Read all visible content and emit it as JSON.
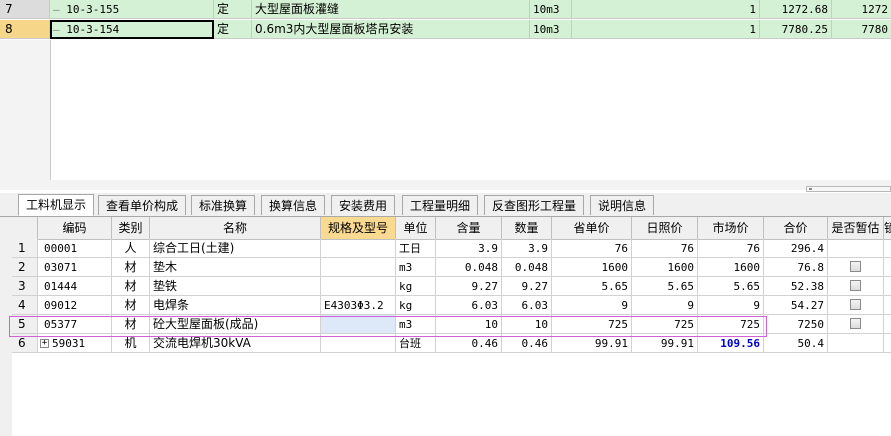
{
  "top_grid": {
    "rows": [
      {
        "num": "7",
        "code": "10-3-155",
        "type": "定",
        "name": "大型屋面板灌缝",
        "unit": "10m3",
        "qty": "1",
        "price": "1272.68",
        "total": "1272",
        "selected": false
      },
      {
        "num": "8",
        "code": "10-3-154",
        "type": "定",
        "name": "0.6m3内大型屋面板塔吊安装",
        "unit": "10m3",
        "qty": "1",
        "price": "7780.25",
        "total": "7780",
        "selected": true
      }
    ]
  },
  "tabs": [
    {
      "label": "工料机显示",
      "active": true
    },
    {
      "label": "查看单价构成",
      "active": false
    },
    {
      "label": "标准换算",
      "active": false
    },
    {
      "label": "换算信息",
      "active": false
    },
    {
      "label": "安装费用",
      "active": false
    },
    {
      "label": "工程量明细",
      "active": false
    },
    {
      "label": "反查图形工程量",
      "active": false
    },
    {
      "label": "说明信息",
      "active": false
    }
  ],
  "bottom_grid": {
    "headers": {
      "code": "编码",
      "type": "类别",
      "name": "名称",
      "spec": "规格及型号",
      "unit": "单位",
      "content": "含量",
      "quantity": "数量",
      "prov_price": "省单价",
      "ref_price": "日照价",
      "market_price": "市场价",
      "total_price": "合价",
      "provisional": "是否暂估",
      "extra": "锁"
    },
    "rows": [
      {
        "num": "1",
        "code": "00001",
        "type": "人",
        "name": "综合工日(土建)",
        "spec": "",
        "unit": "工日",
        "content": "3.9",
        "quantity": "3.9",
        "prov_price": "76",
        "ref_price": "76",
        "market_price": "76",
        "total_price": "296.4",
        "checkbox": false
      },
      {
        "num": "2",
        "code": "03071",
        "type": "材",
        "name": "垫木",
        "spec": "",
        "unit": "m3",
        "content": "0.048",
        "quantity": "0.048",
        "prov_price": "1600",
        "ref_price": "1600",
        "market_price": "1600",
        "total_price": "76.8",
        "checkbox": true
      },
      {
        "num": "3",
        "code": "01444",
        "type": "材",
        "name": "垫铁",
        "spec": "",
        "unit": "kg",
        "content": "9.27",
        "quantity": "9.27",
        "prov_price": "5.65",
        "ref_price": "5.65",
        "market_price": "5.65",
        "total_price": "52.38",
        "checkbox": true
      },
      {
        "num": "4",
        "code": "09012",
        "type": "材",
        "name": "电焊条",
        "spec": "E4303Φ3.2",
        "unit": "kg",
        "content": "6.03",
        "quantity": "6.03",
        "prov_price": "9",
        "ref_price": "9",
        "market_price": "9",
        "total_price": "54.27",
        "checkbox": true
      },
      {
        "num": "5",
        "code": "05377",
        "type": "材",
        "name": "砼大型屋面板(成品)",
        "spec": "",
        "unit": "m3",
        "content": "10",
        "quantity": "10",
        "prov_price": "725",
        "ref_price": "725",
        "market_price": "725",
        "total_price": "7250",
        "checkbox": true
      },
      {
        "num": "6",
        "code": "59031",
        "type": "机",
        "name": "交流电焊机30kVA",
        "spec": "",
        "unit": "台班",
        "content": "0.46",
        "quantity": "0.46",
        "prov_price": "99.91",
        "ref_price": "99.91",
        "market_price": "109.56",
        "total_price": "50.4",
        "checkbox": false,
        "expander": "+"
      }
    ]
  },
  "colors": {
    "selected_row_num": "#f6d78a",
    "green_cell": "#d5f1d5",
    "header_highlight": "#fad991",
    "market_price_changed": "#0000cc",
    "row_outline": "#d060d8"
  }
}
